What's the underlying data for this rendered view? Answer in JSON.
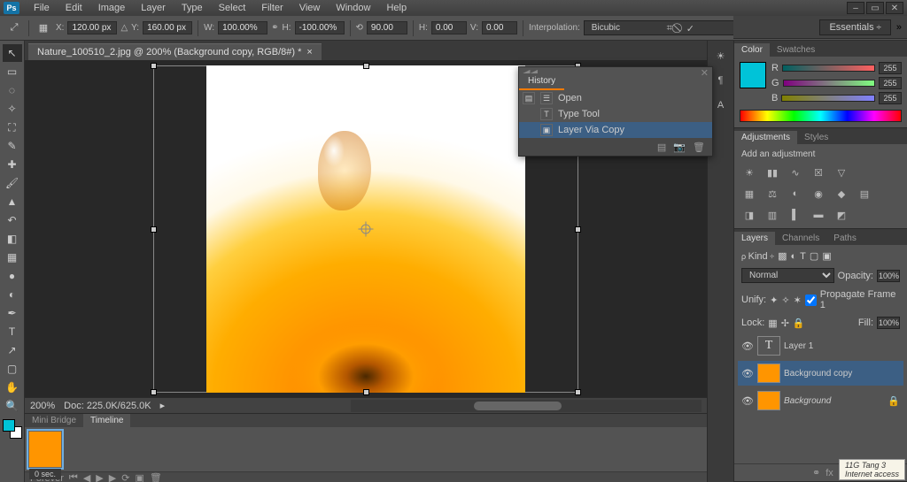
{
  "app": {
    "logo": "Ps"
  },
  "menu": [
    "File",
    "Edit",
    "Image",
    "Layer",
    "Type",
    "Select",
    "Filter",
    "View",
    "Window",
    "Help"
  ],
  "options": {
    "x_label": "X:",
    "x": "120.00 px",
    "y_label": "Y:",
    "y": "160.00 px",
    "w_label": "W:",
    "w": "100.00%",
    "h_label": "H:",
    "h": "-100.00%",
    "angle_label": "",
    "angle": "90.00",
    "hskew_label": "H:",
    "hskew": "0.00",
    "vskew_label": "V:",
    "vskew": "0.00",
    "interp_label": "Interpolation:",
    "interp": "Bicubic"
  },
  "workspace": {
    "preset": "Essentials"
  },
  "document": {
    "tab": "Nature_100510_2.jpg @ 200% (Background copy, RGB/8#) *",
    "zoom": "200%",
    "doc": "Doc: 225.0K/625.0K"
  },
  "history": {
    "title": "History",
    "items": [
      "Open",
      "Type Tool",
      "Layer Via Copy"
    ]
  },
  "color": {
    "tab1": "Color",
    "tab2": "Swatches",
    "r_label": "R",
    "r_val": "255",
    "g_label": "G",
    "g_val": "255",
    "b_label": "B",
    "b_val": "255"
  },
  "adjustments": {
    "tab1": "Adjustments",
    "tab2": "Styles",
    "label": "Add an adjustment"
  },
  "layers": {
    "tab1": "Layers",
    "tab2": "Channels",
    "tab3": "Paths",
    "kind": "Kind",
    "blend": "Normal",
    "opacity_lbl": "Opacity:",
    "opacity": "100%",
    "unify": "Unify:",
    "propagate": "Propagate Frame 1",
    "lock": "Lock:",
    "fill_lbl": "Fill:",
    "fill": "100%",
    "items": [
      {
        "name": "Layer 1",
        "type": "text"
      },
      {
        "name": "Background copy",
        "type": "image"
      },
      {
        "name": "Background",
        "type": "image",
        "locked": true
      }
    ]
  },
  "timeline": {
    "tab1": "Mini Bridge",
    "tab2": "Timeline",
    "frame_duration": "0 sec.",
    "loop": "Forever"
  },
  "tooltip": {
    "line1": "11G Tang 3",
    "line2": "Internet access"
  }
}
